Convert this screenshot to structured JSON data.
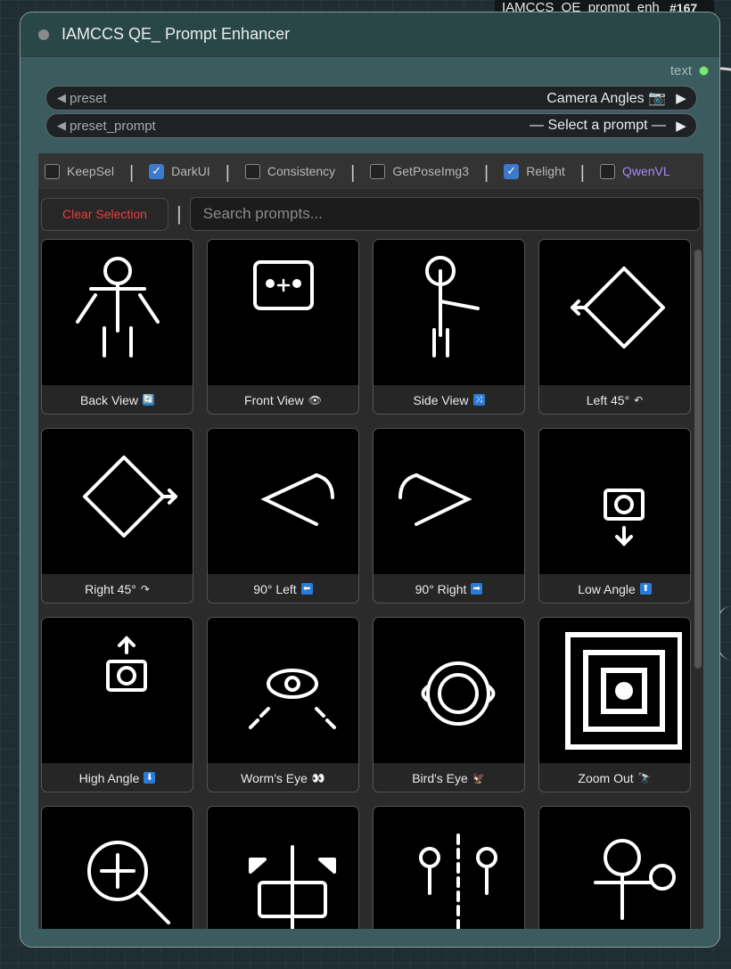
{
  "canvas": {
    "title_tab": "IAMCCS_QE_prompt_enh",
    "node_id": "#167"
  },
  "node": {
    "title": "IAMCCS QE_ Prompt Enhancer",
    "output_label": "text",
    "widgets": {
      "preset": {
        "name": "preset",
        "value": "Camera Angles 📷"
      },
      "preset_prompt": {
        "name": "preset_prompt",
        "value": "— Select a prompt —"
      }
    },
    "checkboxes": [
      {
        "label": "KeepSel",
        "checked": false
      },
      {
        "label": "DarkUI",
        "checked": true
      },
      {
        "label": "Consistency",
        "checked": false
      },
      {
        "label": "GetPoseImg3",
        "checked": false
      },
      {
        "label": "Relight",
        "checked": true
      },
      {
        "label": "QwenVL",
        "checked": false
      }
    ],
    "clear_label": "Clear Selection",
    "search_placeholder": "Search prompts...",
    "cards": [
      {
        "label": "Back View",
        "icon": "back-view-icon",
        "emoji": "🔄",
        "style": "blue"
      },
      {
        "label": "Front View",
        "icon": "front-view-icon",
        "emoji": "👁",
        "style": "emoji"
      },
      {
        "label": "Side View",
        "icon": "side-view-icon",
        "emoji": "⤨",
        "style": "blue"
      },
      {
        "label": "Left 45°",
        "icon": "left-45-icon",
        "emoji": "↶",
        "style": "plain"
      },
      {
        "label": "Right 45°",
        "icon": "right-45-icon",
        "emoji": "↷",
        "style": "plain"
      },
      {
        "label": "90° Left",
        "icon": "ninety-left-icon",
        "emoji": "⬅",
        "style": "blue"
      },
      {
        "label": "90° Right",
        "icon": "ninety-right-icon",
        "emoji": "➡",
        "style": "blue"
      },
      {
        "label": "Low Angle",
        "icon": "low-angle-icon",
        "emoji": "⬆",
        "style": "blue"
      },
      {
        "label": "High Angle",
        "icon": "high-angle-icon",
        "emoji": "⬇",
        "style": "blue"
      },
      {
        "label": "Worm's Eye",
        "icon": "worms-eye-icon",
        "emoji": "👀",
        "style": "emoji"
      },
      {
        "label": "Bird's Eye",
        "icon": "birds-eye-icon",
        "emoji": "🦅",
        "style": "emoji"
      },
      {
        "label": "Zoom Out",
        "icon": "zoom-out-icon",
        "emoji": "🔭",
        "style": "emoji"
      },
      {
        "label": "",
        "icon": "zoom-in-icon",
        "emoji": "",
        "style": "none"
      },
      {
        "label": "",
        "icon": "frame-split-icon",
        "emoji": "",
        "style": "none"
      },
      {
        "label": "",
        "icon": "two-shot-icon",
        "emoji": "",
        "style": "none"
      },
      {
        "label": "",
        "icon": "over-shoulder-icon",
        "emoji": "",
        "style": "none"
      }
    ]
  }
}
